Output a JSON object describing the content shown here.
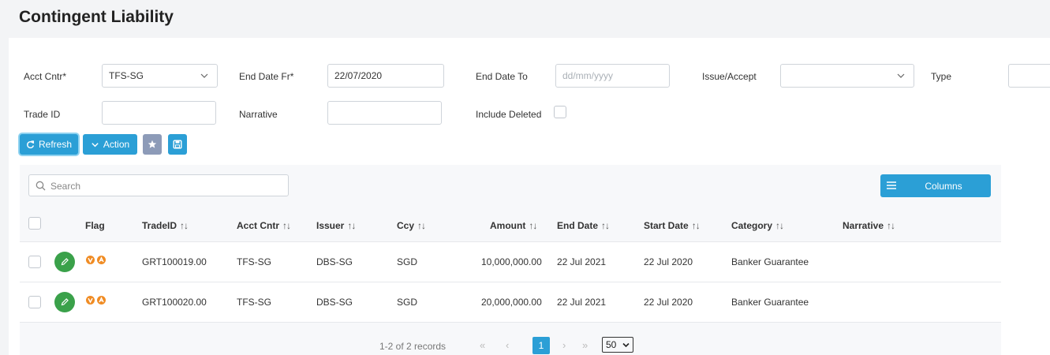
{
  "page": {
    "title": "Contingent Liability"
  },
  "filters": {
    "acct_cntr": {
      "label": "Acct Cntr*",
      "value": "TFS-SG"
    },
    "end_date_fr": {
      "label": "End Date Fr*",
      "value": "22/07/2020"
    },
    "end_date_to": {
      "label": "End Date To",
      "placeholder": "dd/mm/yyyy"
    },
    "issue_accept": {
      "label": "Issue/Accept",
      "value": ""
    },
    "type": {
      "label": "Type",
      "value": ""
    },
    "trade_id": {
      "label": "Trade ID",
      "value": ""
    },
    "narrative": {
      "label": "Narrative",
      "value": ""
    },
    "include_deleted": {
      "label": "Include Deleted",
      "checked": false
    }
  },
  "toolbar": {
    "refresh_label": "Refresh",
    "action_label": "Action"
  },
  "grid": {
    "search_placeholder": "Search",
    "columns_label": "Columns",
    "headers": {
      "flag": "Flag",
      "trade_id": "TradeID",
      "acct_cntr": "Acct Cntr",
      "issuer": "Issuer",
      "ccy": "Ccy",
      "amount": "Amount",
      "end_date": "End Date",
      "start_date": "Start Date",
      "category": "Category",
      "narrative": "Narrative"
    },
    "sort_glyph": "↑↓",
    "rows": [
      {
        "trade_id": "GRT100019.00",
        "acct_cntr": "TFS-SG",
        "issuer": "DBS-SG",
        "ccy": "SGD",
        "amount": "10,000,000.00",
        "end_date": "22 Jul 2021",
        "start_date": "22 Jul 2020",
        "category": "Banker Guarantee",
        "narrative": ""
      },
      {
        "trade_id": "GRT100020.00",
        "acct_cntr": "TFS-SG",
        "issuer": "DBS-SG",
        "ccy": "SGD",
        "amount": "20,000,000.00",
        "end_date": "22 Jul 2021",
        "start_date": "22 Jul 2020",
        "category": "Banker Guarantee",
        "narrative": ""
      }
    ]
  },
  "pager": {
    "records_text": "1-2 of 2 records",
    "current_page": "1",
    "first": "«",
    "prev": "‹",
    "next": "›",
    "last": "»",
    "page_size": "50"
  },
  "colors": {
    "accent": "#2b9fd6",
    "edit_green": "#3aa14a",
    "flag_orange": "#f08c24"
  }
}
